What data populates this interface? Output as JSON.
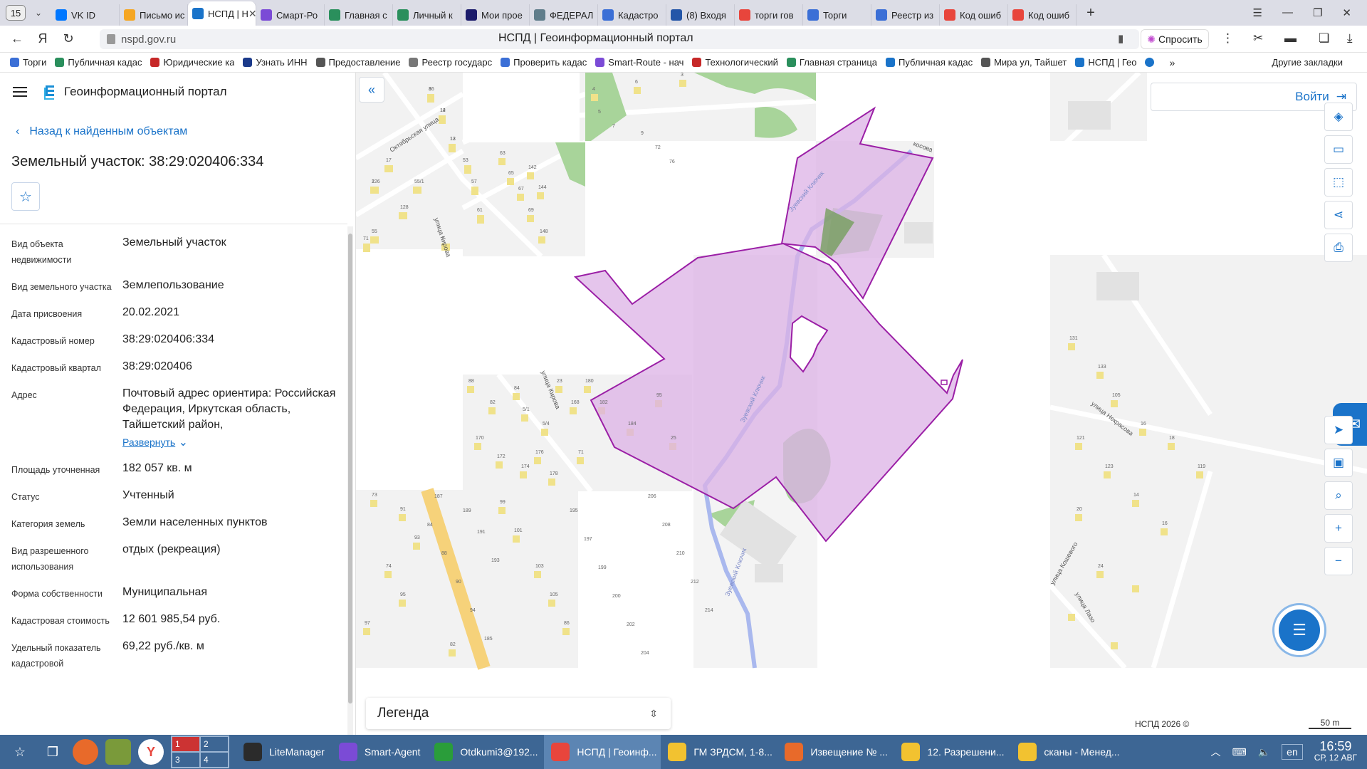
{
  "browser": {
    "tab_count": "15",
    "tabs": [
      {
        "label": "VK ID",
        "color": "#0077ff"
      },
      {
        "label": "Письмо ис",
        "color": "#f5a623"
      },
      {
        "label": "НСПД | Н",
        "color": "#1a73c9",
        "active": true
      },
      {
        "label": "Смарт-Ро",
        "color": "#7b4bd6"
      },
      {
        "label": "Главная с",
        "color": "#2a8f5c"
      },
      {
        "label": "Личный к",
        "color": "#2a8f5c"
      },
      {
        "label": "Мои прое",
        "color": "#1b1b6b"
      },
      {
        "label": "ФЕДЕРАЛ",
        "color": "#607d8b"
      },
      {
        "label": "Кадастро",
        "color": "#3b6fd6"
      },
      {
        "label": "(8) Входя",
        "color": "#2456a8"
      },
      {
        "label": "торги гов",
        "color": "#e8453c"
      },
      {
        "label": "Торги",
        "color": "#3b6fd6"
      },
      {
        "label": "Реестр из",
        "color": "#3b6fd6"
      },
      {
        "label": "Код ошиб",
        "color": "#e8453c"
      },
      {
        "label": "Код ошиб",
        "color": "#e8453c"
      }
    ],
    "url": "nspd.gov.ru",
    "page_title": "НСПД | Геоинформационный портал",
    "ask_label": "Спросить",
    "bookmarks": [
      {
        "label": "Торги",
        "color": "#3b6fd6"
      },
      {
        "label": "Публичная кадас",
        "color": "#2a8f5c"
      },
      {
        "label": "Юридические ка",
        "color": "#c62828"
      },
      {
        "label": "Узнать ИНН",
        "color": "#1b3a8a"
      },
      {
        "label": "Предоставление",
        "color": "#555"
      },
      {
        "label": "Реестр государс",
        "color": "#777"
      },
      {
        "label": "Проверить кадас",
        "color": "#3b6fd6"
      },
      {
        "label": "Smart-Route - нач",
        "color": "#7b4bd6"
      },
      {
        "label": "Технологический",
        "color": "#c62828"
      },
      {
        "label": "Главная страница",
        "color": "#2a8f5c"
      },
      {
        "label": "Публичная кадас",
        "color": "#1a73c9"
      },
      {
        "label": "Мира ул, Тайшет",
        "color": "#555"
      },
      {
        "label": "НСПД | Гео",
        "color": "#1a73c9"
      }
    ],
    "other_bookmarks": "Другие закладки"
  },
  "panel": {
    "app_title": "Геоинформационный портал",
    "back_label": "Назад к найденным объектам",
    "object_title": "Земельный участок: 38:29:020406:334",
    "attributes": [
      {
        "key": "Вид объекта недвижимости",
        "value": "Земельный участок"
      },
      {
        "key": "Вид земельного участка",
        "value": "Землепользование"
      },
      {
        "key": "Дата присвоения",
        "value": "20.02.2021"
      },
      {
        "key": "Кадастровый номер",
        "value": "38:29:020406:334"
      },
      {
        "key": "Кадастровый квартал",
        "value": "38:29:020406"
      },
      {
        "key": "Адрес",
        "value": "Почтовый адрес ориентира: Российская Федерация, Иркутская область, Тайшетский район,",
        "expand": "Развернуть"
      },
      {
        "key": "Площадь уточненная",
        "value": "182 057 кв. м"
      },
      {
        "key": "Статус",
        "value": "Учтенный"
      },
      {
        "key": "Категория земель",
        "value": "Земли населенных пунктов"
      },
      {
        "key": "Вид разрешенного использования",
        "value": "отдых (рекреация)"
      },
      {
        "key": "Форма собственности",
        "value": "Муниципальная"
      },
      {
        "key": "Кадастровая стоимость",
        "value": "12 601 985,54 руб."
      },
      {
        "key": "Удельный показатель кадастровой",
        "value": "69,22 руб./кв. м"
      }
    ]
  },
  "map": {
    "login_label": "Войти",
    "legend_label": "Легенда",
    "copyright": "НСПД 2026 ©",
    "scale_label": "50 m",
    "street_labels": [
      "Октябрьская улица",
      "улица Кирова",
      "улица Кирова",
      "Зуевский Ключик",
      "Зуевский Ключик",
      "улица Некрасова",
      "улица Кошевого",
      "улица Лазо",
      "Зуевский Ключик",
      "косова"
    ],
    "house_numbers": [
      "16",
      "14",
      "12",
      "126",
      "17",
      "128",
      "55/1",
      "55",
      "53",
      "57",
      "61",
      "63",
      "65",
      "67",
      "69",
      "148",
      "142",
      "144",
      "71",
      "2",
      "4",
      "6",
      "3",
      "5",
      "7",
      "9",
      "72",
      "76",
      "88",
      "82",
      "84",
      "5/1",
      "5/4",
      "23",
      "168",
      "170",
      "172",
      "174",
      "176",
      "178",
      "180",
      "182",
      "184",
      "95",
      "25",
      "71",
      "73",
      "91",
      "93",
      "74",
      "95",
      "97",
      "99",
      "101",
      "103",
      "105",
      "86",
      "82",
      "84",
      "88",
      "90",
      "94",
      "185",
      "187",
      "189",
      "191",
      "193",
      "195",
      "197",
      "199",
      "200",
      "202",
      "204",
      "206",
      "208",
      "210",
      "212",
      "214",
      "131",
      "133",
      "105",
      "16",
      "18",
      "119",
      "121",
      "123",
      "14",
      "16",
      "20",
      "24",
      "8",
      "12",
      "13",
      "2"
    ],
    "colors": {
      "parcel_fill": "#dcb2e6",
      "parcel_stroke": "#9b1fa6",
      "green": "#a8d49a",
      "block": "#efefef",
      "house": "#f0e28a",
      "river": "#a9b8ee",
      "road_major": "#f6d27a"
    }
  },
  "taskbar": {
    "pager": [
      "1",
      "2",
      "3",
      "4"
    ],
    "apps": [
      {
        "label": "LiteManager",
        "color": "#2b2b2b"
      },
      {
        "label": "Smart-Agent",
        "color": "#7b4bd6"
      },
      {
        "label": "Otdkumi3@192...",
        "color": "#2a9d3a"
      },
      {
        "label": "НСПД | Геоинф...",
        "color": "#e8453c",
        "active": true
      },
      {
        "label": "ГМ ЗРДСМ, 1-8...",
        "color": "#f2c230"
      },
      {
        "label": "Извещение № ...",
        "color": "#e86a2a"
      },
      {
        "label": "12. Разрешени...",
        "color": "#f2c230"
      },
      {
        "label": "сканы - Менед...",
        "color": "#f2c230"
      }
    ],
    "lang": "en",
    "time": "16:59",
    "date": "СР, 12 АВГ"
  }
}
